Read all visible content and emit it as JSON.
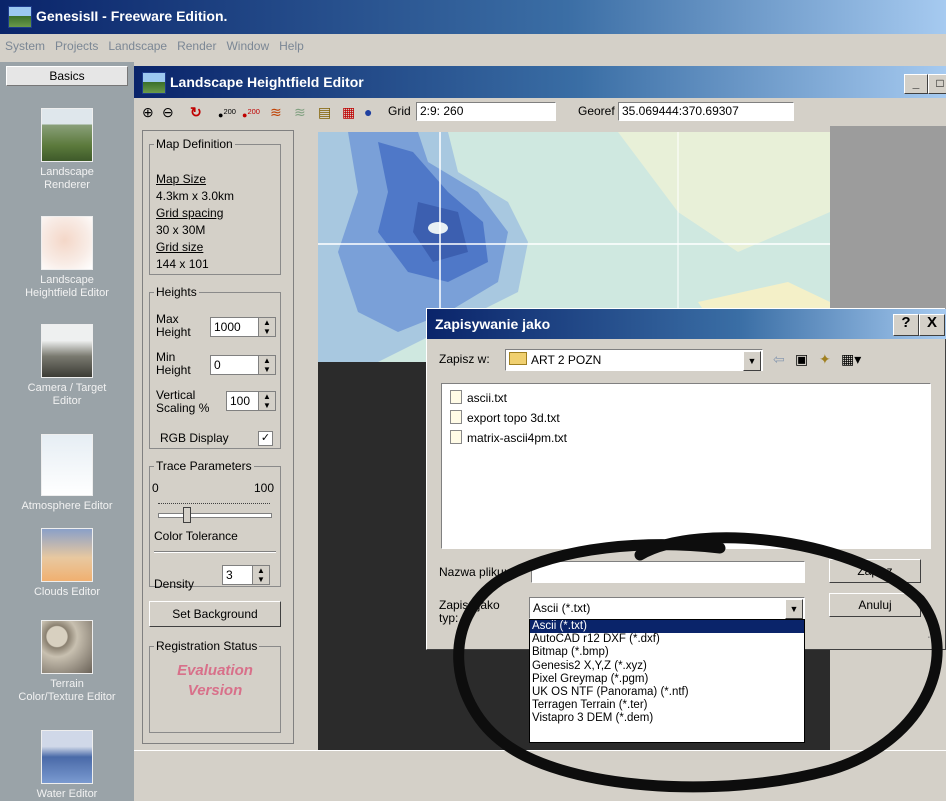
{
  "app": {
    "title": "GenesisII - Freeware Edition.",
    "menu": [
      "System",
      "Projects",
      "Landscape",
      "Render",
      "Window",
      "Help"
    ]
  },
  "basics": {
    "header": "Basics",
    "tools": [
      {
        "label1": "Landscape",
        "label2": "Renderer",
        "icon": "landscape-renderer-icon"
      },
      {
        "label1": "Landscape",
        "label2": "Heightfield Editor",
        "icon": "heightfield-editor-icon"
      },
      {
        "label1": "Camera / Target",
        "label2": "Editor",
        "icon": "camera-target-icon"
      },
      {
        "label1": "Atmosphere Editor",
        "label2": "",
        "icon": "atmosphere-icon"
      },
      {
        "label1": "Clouds Editor",
        "label2": "",
        "icon": "clouds-icon"
      },
      {
        "label1": "Terrain",
        "label2": "Color/Texture Editor",
        "icon": "terrain-texture-icon"
      },
      {
        "label1": "Water Editor",
        "label2": "",
        "icon": "water-icon"
      }
    ]
  },
  "editor": {
    "title": "Landscape Heightfield Editor",
    "grid_label": "Grid",
    "grid_value": "2:9:  260",
    "georef_label": "Georef",
    "georef_value": "35.069444:370.69307",
    "map_definition": {
      "legend": "Map Definition",
      "map_size_label": "Map Size",
      "map_size_value": "4.3km x 3.0km",
      "grid_spacing_label": "Grid spacing",
      "grid_spacing_value": "30 x 30M",
      "grid_size_label": "Grid size",
      "grid_size_value": "144 x 101"
    },
    "heights": {
      "legend": "Heights",
      "max_label1": "Max",
      "max_label2": "Height",
      "max_value": "1000",
      "min_label1": "Min",
      "min_label2": "Height",
      "min_value": "0",
      "vs_label1": "Vertical",
      "vs_label2": "Scaling %",
      "vs_value": "100",
      "rgb_label": "RGB Display",
      "rgb_checked": "✓"
    },
    "trace": {
      "legend": "Trace Parameters",
      "min": "0",
      "max": "100",
      "tolerance_label": "Color Tolerance",
      "tolerance_fraction": 0.25,
      "density_label": "Density",
      "density_value": "3"
    },
    "set_background": "Set Background",
    "registration": {
      "legend": "Registration Status",
      "line1": "Evaluation",
      "line2": "Version"
    }
  },
  "dialog": {
    "title": "Zapisywanie jako",
    "help": "?",
    "close": "X",
    "save_in_label": "Zapisz w:",
    "save_in_value": "ART 2 POZN",
    "files": [
      "ascii.txt",
      "export topo 3d.txt",
      "matrix-ascii4pm.txt"
    ],
    "filename_label": "Nazwa pliku:",
    "filename_value": "",
    "save_button": "Zapisz",
    "type_label1": "Zapisz jako",
    "type_label2": "typ:",
    "type_value": "Ascii (*.txt)",
    "cancel_button": "Anuluj",
    "type_options": [
      "Ascii (*.txt)",
      "AutoCAD r12 DXF (*.dxf)",
      "Bitmap (*.bmp)",
      "Genesis2 X,Y,Z (*.xyz)",
      "Pixel Greymap (*.pgm)",
      "UK OS NTF (Panorama) (*.ntf)",
      "Terragen Terrain (*.ter)",
      "Vistapro 3  DEM (*.dem)"
    ]
  },
  "colors": {
    "titlebar_start": "#0a246a",
    "titlebar_end": "#a6caf0",
    "selection": "#0a246a",
    "evaluation_text": "#d8708a"
  }
}
